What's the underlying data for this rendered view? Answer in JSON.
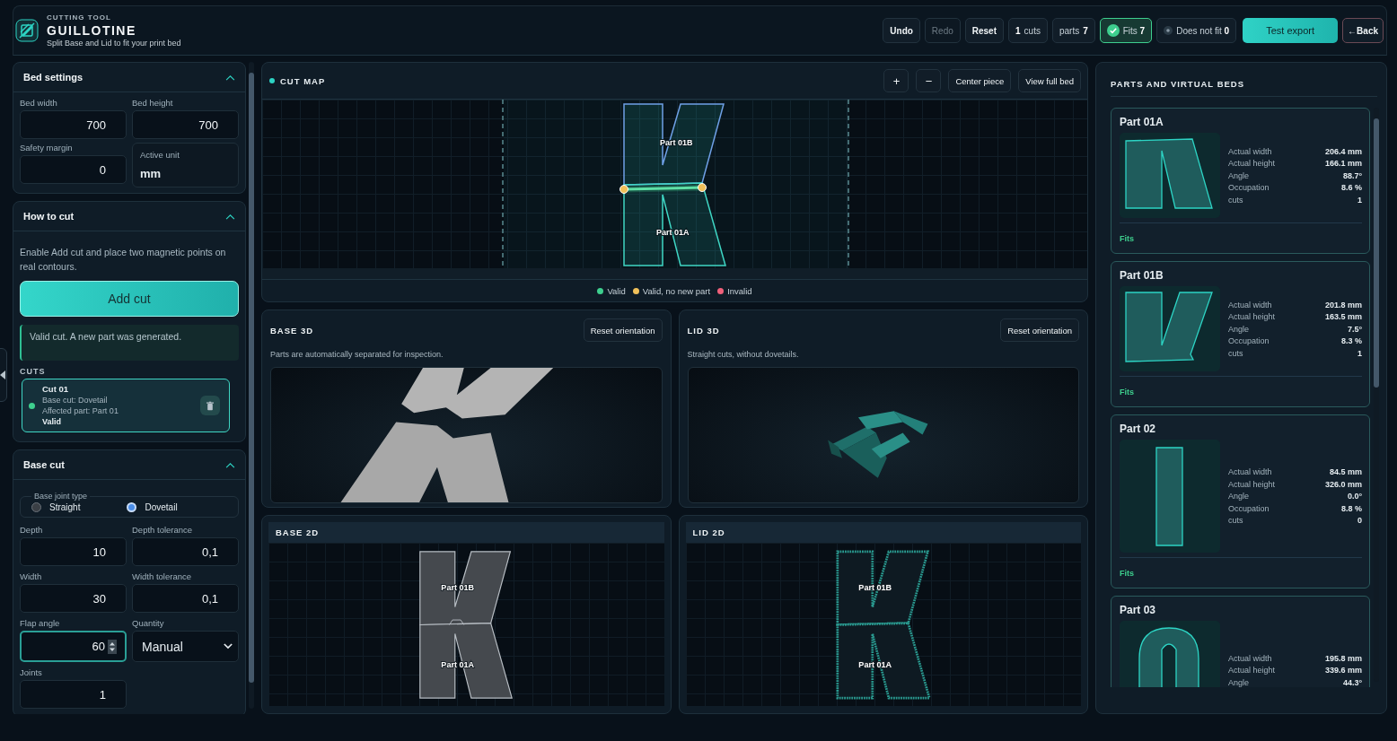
{
  "header": {
    "kicker": "CUTTING TOOL",
    "title": "GUILLOTINE",
    "subtitle": "Split Base and Lid to fit your print bed"
  },
  "toolbar": {
    "actions": [
      {
        "label": "Undo",
        "disabled": false
      },
      {
        "label": "Redo",
        "disabled": true
      },
      {
        "label": "Reset",
        "disabled": false
      }
    ],
    "counters": [
      {
        "kind": "value-first",
        "value": "1",
        "label": "cuts"
      },
      {
        "kind": "value-last",
        "label": "parts",
        "value": "7"
      },
      {
        "kind": "fits",
        "label": "Fits",
        "value": "7"
      },
      {
        "kind": "not-fit",
        "label": "Does not fit",
        "value": "0"
      }
    ],
    "export_button": "Test export",
    "back_button": "←Back"
  },
  "bed_settings": {
    "title": "Bed settings",
    "expanded": true,
    "fields": [
      {
        "label": "Bed width",
        "value": "700"
      },
      {
        "label": "Bed height",
        "value": "700"
      },
      {
        "label": "Safety margin",
        "value": "0"
      }
    ],
    "unit": {
      "label": "Active unit",
      "value": "mm"
    }
  },
  "how_to_cut": {
    "title": "How to cut",
    "expanded": true,
    "hint": "Enable Add cut and place two magnetic points on real contours.",
    "add_button": "Add cut",
    "message": "Valid cut. A new part was generated.",
    "cuts_heading": "CUTS",
    "cuts": [
      {
        "title": "Cut 01",
        "base_cut": "Base cut: Dovetail",
        "affected": "Affected part: Part 01",
        "status": "Valid",
        "color": "#3ecf8e",
        "selected": true
      }
    ]
  },
  "base_cut": {
    "title": "Base cut",
    "expanded": true,
    "joint_legend": "Base joint type",
    "joint_options": [
      {
        "label": "Straight",
        "selected": false
      },
      {
        "label": "Dovetail",
        "selected": true
      }
    ],
    "fields": [
      {
        "kind": "number",
        "label": "Depth",
        "value": "10",
        "focused": false
      },
      {
        "kind": "number",
        "label": "Depth tolerance",
        "value": "0,1",
        "focused": false
      },
      {
        "kind": "number",
        "label": "Width",
        "value": "30",
        "focused": false
      },
      {
        "kind": "number",
        "label": "Width tolerance",
        "value": "0,1",
        "focused": false
      },
      {
        "kind": "number",
        "label": "Flap angle",
        "value": "60",
        "focused": true
      },
      {
        "kind": "select",
        "label": "Quantity",
        "value": "Manual"
      },
      {
        "kind": "number",
        "label": "Joints",
        "value": "1",
        "focused": false
      }
    ]
  },
  "cut_map": {
    "title": "CUT MAP",
    "zoom_in": "+",
    "zoom_out": "−",
    "center_button": "Center piece",
    "full_bed_button": "View full bed",
    "labels": [
      "Part 01B",
      "Part 01A"
    ],
    "legend": [
      {
        "label": "Valid",
        "color": "#3ecf8e"
      },
      {
        "label": "Valid, no new part",
        "color": "#f0c05a"
      },
      {
        "label": "Invalid",
        "color": "#f0607a"
      }
    ]
  },
  "views_3d": [
    {
      "kind": "base",
      "title": "BASE 3D",
      "button": "Reset orientation",
      "caption": "Parts are automatically separated for inspection."
    },
    {
      "kind": "lid",
      "title": "LID 3D",
      "button": "Reset orientation",
      "caption": "Straight cuts, without dovetails."
    }
  ],
  "views_2d": [
    {
      "kind": "base",
      "title": "BASE 2D",
      "labels": [
        "Part 01B",
        "Part 01A"
      ]
    },
    {
      "kind": "lid",
      "title": "LID 2D",
      "labels": [
        "Part 01B",
        "Part 01A"
      ]
    }
  ],
  "parts_panel": {
    "title": "PARTS AND VIRTUAL BEDS",
    "parts": [
      {
        "name": "Part 01A",
        "kind": "lower-k",
        "status": "Fits",
        "stats": [
          {
            "label": "Actual width",
            "value": "206.4 mm"
          },
          {
            "label": "Actual height",
            "value": "166.1 mm"
          },
          {
            "label": "Angle",
            "value": "88.7°"
          },
          {
            "label": "Occupation",
            "value": "8.6 %"
          },
          {
            "label": "cuts",
            "value": "1"
          }
        ]
      },
      {
        "name": "Part 01B",
        "kind": "upper-k",
        "status": "Fits",
        "stats": [
          {
            "label": "Actual width",
            "value": "201.8 mm"
          },
          {
            "label": "Actual height",
            "value": "163.5 mm"
          },
          {
            "label": "Angle",
            "value": "7.5°"
          },
          {
            "label": "Occupation",
            "value": "8.3 %"
          },
          {
            "label": "cuts",
            "value": "1"
          }
        ]
      },
      {
        "name": "Part 02",
        "kind": "bar",
        "status": "Fits",
        "stats": [
          {
            "label": "Actual width",
            "value": "84.5 mm"
          },
          {
            "label": "Actual height",
            "value": "326.0 mm"
          },
          {
            "label": "Angle",
            "value": "0.0°"
          },
          {
            "label": "Occupation",
            "value": "8.8 %"
          },
          {
            "label": "cuts",
            "value": "0"
          }
        ]
      },
      {
        "name": "Part 03",
        "kind": "arch",
        "stats": [
          {
            "label": "Actual width",
            "value": "195.8 mm"
          },
          {
            "label": "Actual height",
            "value": "339.6 mm"
          },
          {
            "label": "Angle",
            "value": "44.3°"
          }
        ]
      }
    ]
  }
}
